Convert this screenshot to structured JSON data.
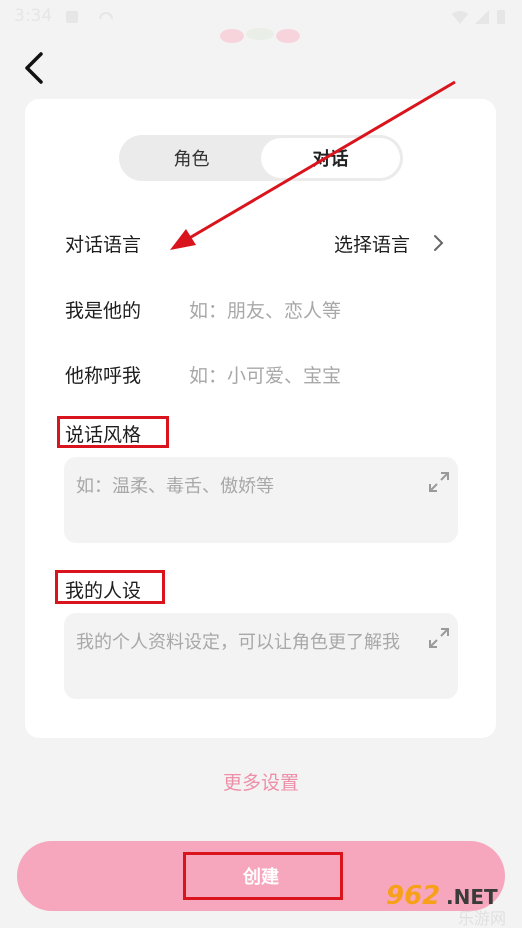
{
  "status_bar": {
    "time": "3:34"
  },
  "tabs": [
    {
      "label": "角色",
      "selected": false
    },
    {
      "label": "对话",
      "selected": true
    }
  ],
  "dialog_language": {
    "label": "对话语言",
    "value": "选择语言"
  },
  "relation": {
    "label": "我是他的",
    "placeholder": "如：朋友、恋人等"
  },
  "nickname": {
    "label": "他称呼我",
    "placeholder": "如：小可爱、宝宝"
  },
  "speaking_style": {
    "title": "说话风格",
    "placeholder": "如：温柔、毒舌、傲娇等"
  },
  "my_persona": {
    "title": "我的人设",
    "placeholder": "我的个人资料设定，可以让角色更了解我"
  },
  "more_settings": "更多设置",
  "create_label": "创建",
  "watermark": {
    "brand": "962.NET",
    "sub": "乐游网"
  },
  "colors": {
    "accent": "#f6a7bd",
    "link": "#ee8fa8",
    "annotation": "#d9141c"
  }
}
